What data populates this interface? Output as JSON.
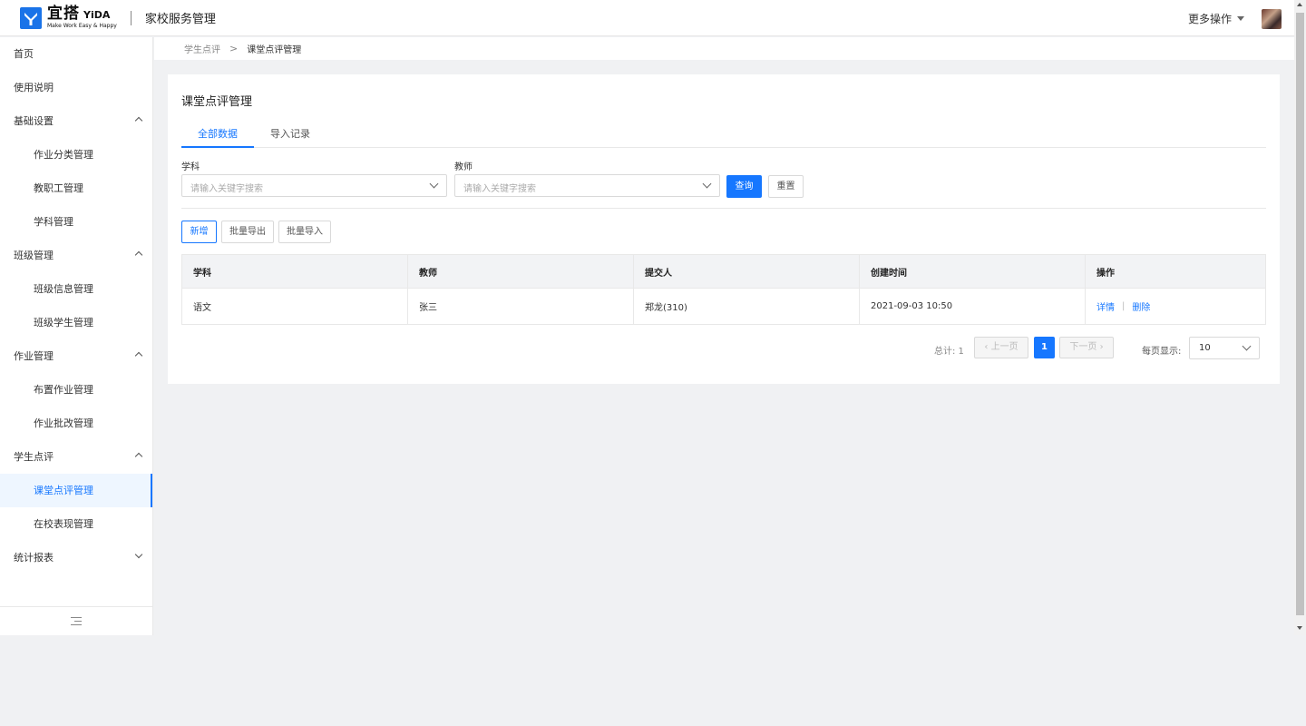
{
  "header": {
    "logo_cn": "宜搭",
    "logo_en": "YiDA",
    "logo_sub": "Make Work Easy & Happy",
    "app_title": "家校服务管理",
    "more_ops": "更多操作"
  },
  "sidebar": {
    "items": [
      {
        "label": "首页"
      },
      {
        "label": "使用说明"
      },
      {
        "label": "基础设置"
      },
      {
        "label": "作业分类管理"
      },
      {
        "label": "教职工管理"
      },
      {
        "label": "学科管理"
      },
      {
        "label": "班级管理"
      },
      {
        "label": "班级信息管理"
      },
      {
        "label": "班级学生管理"
      },
      {
        "label": "作业管理"
      },
      {
        "label": "布置作业管理"
      },
      {
        "label": "作业批改管理"
      },
      {
        "label": "学生点评"
      },
      {
        "label": "课堂点评管理"
      },
      {
        "label": "在校表现管理"
      },
      {
        "label": "统计报表"
      }
    ]
  },
  "breadcrumb": {
    "parent": "学生点评",
    "separator": ">",
    "current": "课堂点评管理"
  },
  "main": {
    "title": "课堂点评管理",
    "tabs": [
      {
        "label": "全部数据"
      },
      {
        "label": "导入记录"
      }
    ],
    "filters": {
      "subject_label": "学科",
      "subject_placeholder": "请输入关键字搜索",
      "teacher_label": "教师",
      "teacher_placeholder": "请输入关键字搜索",
      "query_label": "查询",
      "reset_label": "重置"
    },
    "actions": {
      "add_label": "新增",
      "export_label": "批量导出",
      "import_label": "批量导入"
    },
    "table": {
      "columns": [
        "学科",
        "教师",
        "提交人",
        "创建时间",
        "操作"
      ],
      "rows": [
        {
          "subject": "语文",
          "teacher": "张三",
          "submitter": "郑龙(310)",
          "created": "2021-09-03 10:50",
          "detail": "详情",
          "op_sep": "|",
          "delete": "删除"
        }
      ]
    },
    "pagination": {
      "total": "总计: 1",
      "prev": "上一页",
      "page": "1",
      "next": "下一页",
      "page_size_label": "每页显示:",
      "page_size": "10"
    }
  },
  "colors": {
    "accent": "#1677ff",
    "logo_blue": "#1a73e8"
  }
}
